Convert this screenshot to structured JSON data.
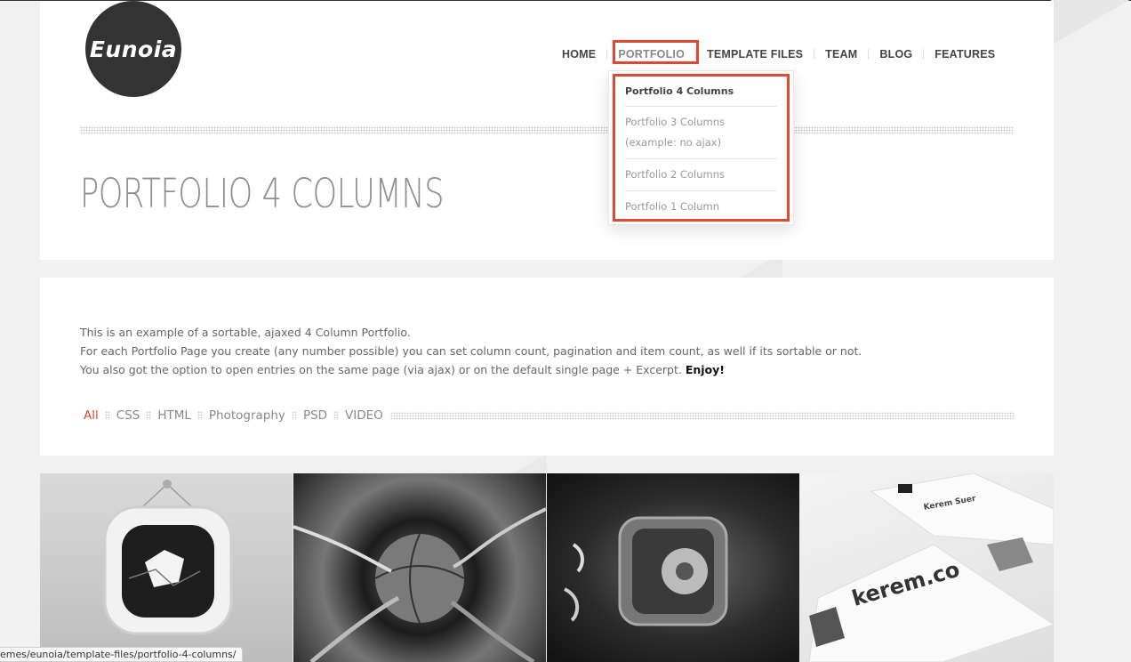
{
  "logo": {
    "text": "Eunoia"
  },
  "nav": {
    "items": [
      {
        "label": "HOME"
      },
      {
        "label": "PORTFOLIO"
      },
      {
        "label": "TEMPLATE FILES"
      },
      {
        "label": "TEAM"
      },
      {
        "label": "BLOG"
      },
      {
        "label": "FEATURES"
      }
    ],
    "active_index": 1
  },
  "dropdown": {
    "items": [
      {
        "label": "Portfolio 4 Columns"
      },
      {
        "label": "Portfolio 3 Columns (example: no ajax)"
      },
      {
        "label": "Portfolio 2 Columns"
      },
      {
        "label": "Portfolio 1 Column"
      }
    ]
  },
  "page_title": "PORTFOLIO 4 COLUMNS",
  "intro": {
    "line1": "This is an example of a sortable, ajaxed 4 Column Portfolio.",
    "line2": "For each Portfolio Page you create (any number possible) you can set column count,  pagination and item count, as well if its sortable or not.",
    "line3": "You also got the option to open entries on the same page (via ajax) or on the default single page + Excerpt.",
    "emphasis": "Enjoy!"
  },
  "filters": [
    {
      "label": "All"
    },
    {
      "label": "CSS"
    },
    {
      "label": "HTML"
    },
    {
      "label": "Photography"
    },
    {
      "label": "PSD"
    },
    {
      "label": "VIDEO"
    }
  ],
  "thumbnails": [
    {
      "name": "tv-icon"
    },
    {
      "name": "basketball-cables"
    },
    {
      "name": "safe-icon"
    },
    {
      "name": "business-cards",
      "text_1": "kerem.co",
      "text_2": "Kerem Suer"
    }
  ],
  "status_bar": {
    "url": "emes/eunoia/template-files/portfolio-4-columns/"
  },
  "colors": {
    "accent": "#e0492e",
    "logo_bg": "#333333",
    "background": "#f1f1f1"
  }
}
